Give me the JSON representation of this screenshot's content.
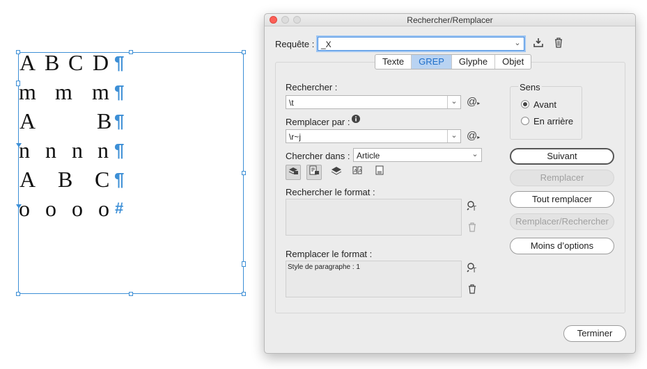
{
  "canvas": {
    "lines": [
      {
        "glyphs": [
          "A",
          "B",
          "C",
          "D"
        ],
        "end": "¶"
      },
      {
        "glyphs": [
          "m",
          "m",
          "m"
        ],
        "end": "¶"
      },
      {
        "glyphs": [
          "A",
          "B"
        ],
        "end": "¶"
      },
      {
        "glyphs": [
          "n",
          "n",
          "n",
          "n"
        ],
        "end": "¶"
      },
      {
        "glyphs": [
          "A",
          "B",
          "C"
        ],
        "end": "¶"
      },
      {
        "glyphs": [
          "o",
          "o",
          "o",
          "o"
        ],
        "end": "#"
      }
    ]
  },
  "dialog": {
    "title": "Rechercher/Remplacer",
    "query_label": "Requête :",
    "query_value": "_X",
    "save_query_icon": "download-icon",
    "delete_query_icon": "trash-icon",
    "tabs": [
      "Texte",
      "GREP",
      "Glyphe",
      "Objet"
    ],
    "active_tab": "GREP",
    "search_label": "Rechercher :",
    "search_value": "\\t",
    "replace_label": "Remplacer par :",
    "replace_value": "\\r~j",
    "special_chars_icon": "@",
    "search_in_label": "Chercher dans :",
    "search_in_value": "Article",
    "find_format_label": "Rechercher le format :",
    "replace_format_label": "Remplacer le format :",
    "replace_format_value": "Style de paragraphe : 1",
    "direction_label": "Sens",
    "direction_forward": "Avant",
    "direction_backward": "En arrière",
    "btn_next": "Suivant",
    "btn_replace": "Remplacer",
    "btn_replace_all": "Tout remplacer",
    "btn_replace_find": "Remplacer/Rechercher",
    "btn_fewer_options": "Moins d’options",
    "btn_done": "Terminer"
  },
  "colors": {
    "accent": "#3d8fd6",
    "tab_active": "#1f6fc9",
    "close": "#fc5f57"
  }
}
